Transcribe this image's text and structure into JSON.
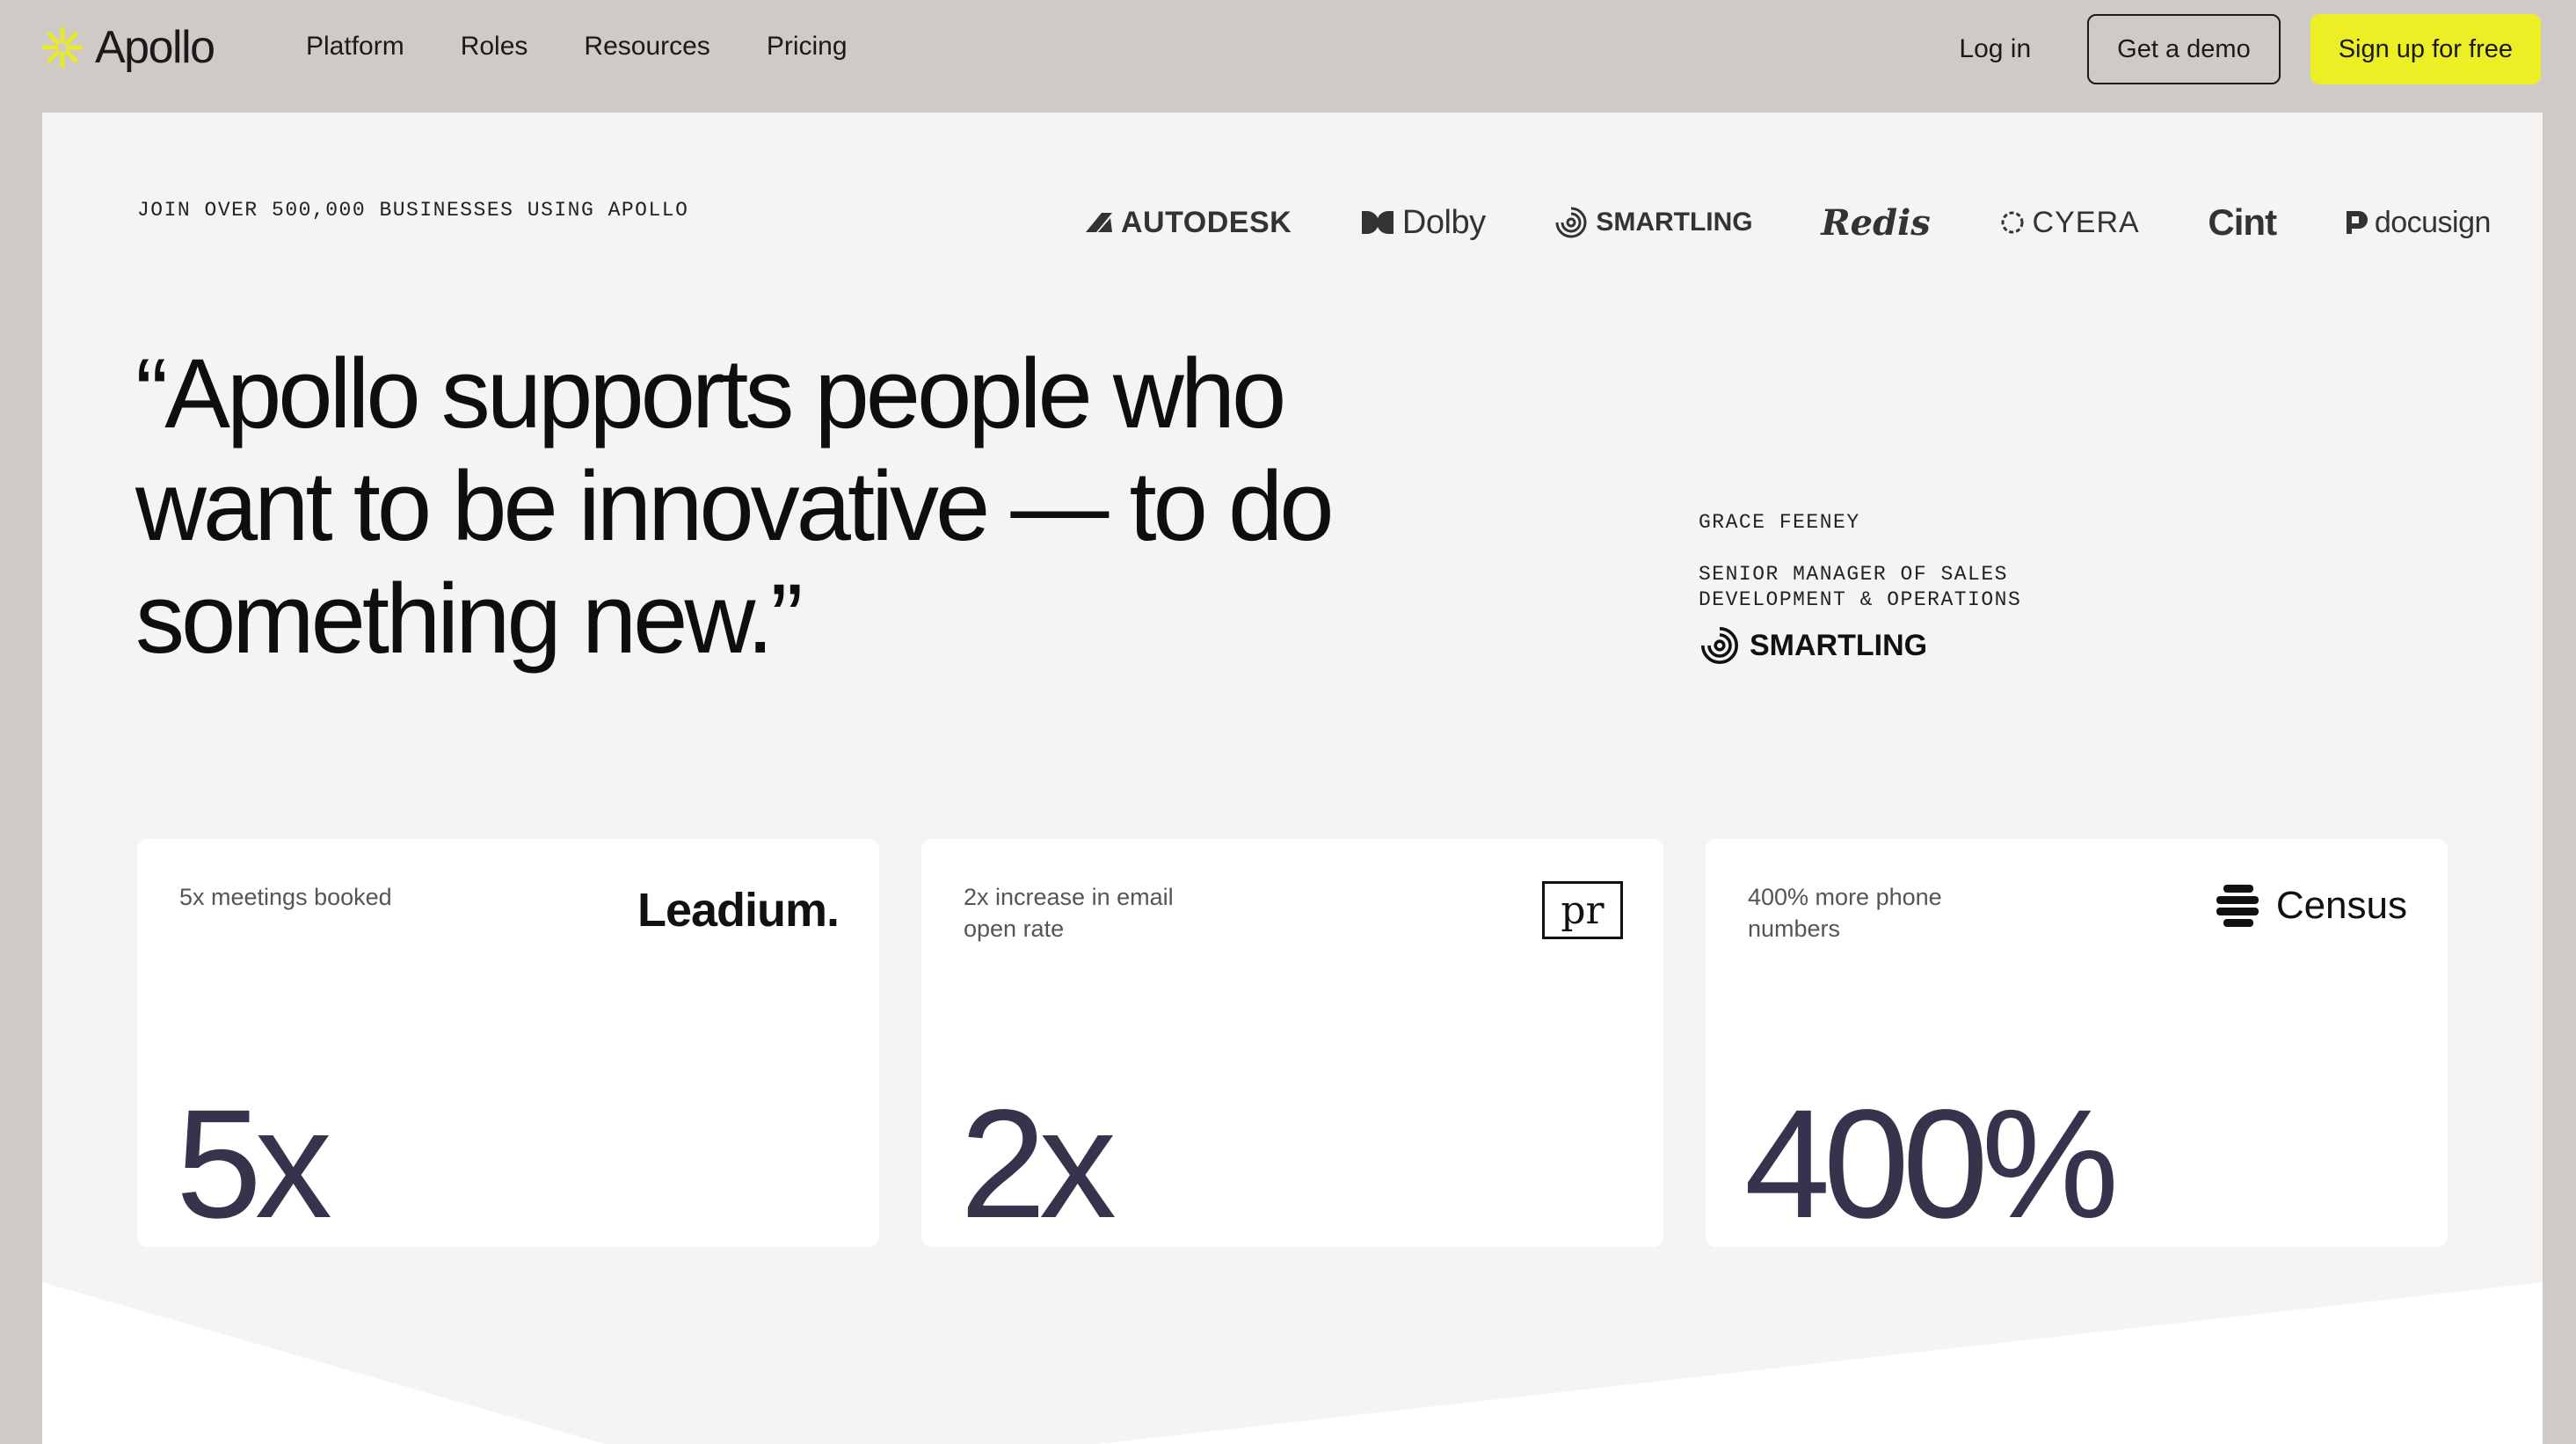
{
  "nav": {
    "brand": "Apollo",
    "links": [
      "Platform",
      "Roles",
      "Resources",
      "Pricing"
    ],
    "login": "Log in",
    "demo": "Get a demo",
    "signup": "Sign up for free",
    "accent_color": "#ecef24"
  },
  "trust": {
    "headline": "JOIN OVER 500,000 BUSINESSES USING APOLLO",
    "brands": [
      "AUTODESK",
      "Dolby",
      "SMARTLING",
      "Redis",
      "CYERA",
      "Cint",
      "docusign"
    ]
  },
  "testimonial": {
    "quote_lines": [
      "“Apollo supports people who",
      "want to be innovative — to do",
      "something new.”"
    ],
    "name": "GRACE FEENEY",
    "role": "SENIOR MANAGER OF SALES DEVELOPMENT & OPERATIONS",
    "company": "SMARTLING"
  },
  "stats": [
    {
      "label": "5x meetings booked",
      "value": "5x",
      "company": "Leadium."
    },
    {
      "label": "2x increase in email open rate",
      "value": "2x",
      "company": "pr"
    },
    {
      "label": "400% more phone numbers",
      "value": "400%",
      "company": "Census"
    }
  ],
  "colors": {
    "page_bg": "#cfcac6",
    "panel_bg": "#f5f4f2",
    "stat_value": "#37334d"
  }
}
